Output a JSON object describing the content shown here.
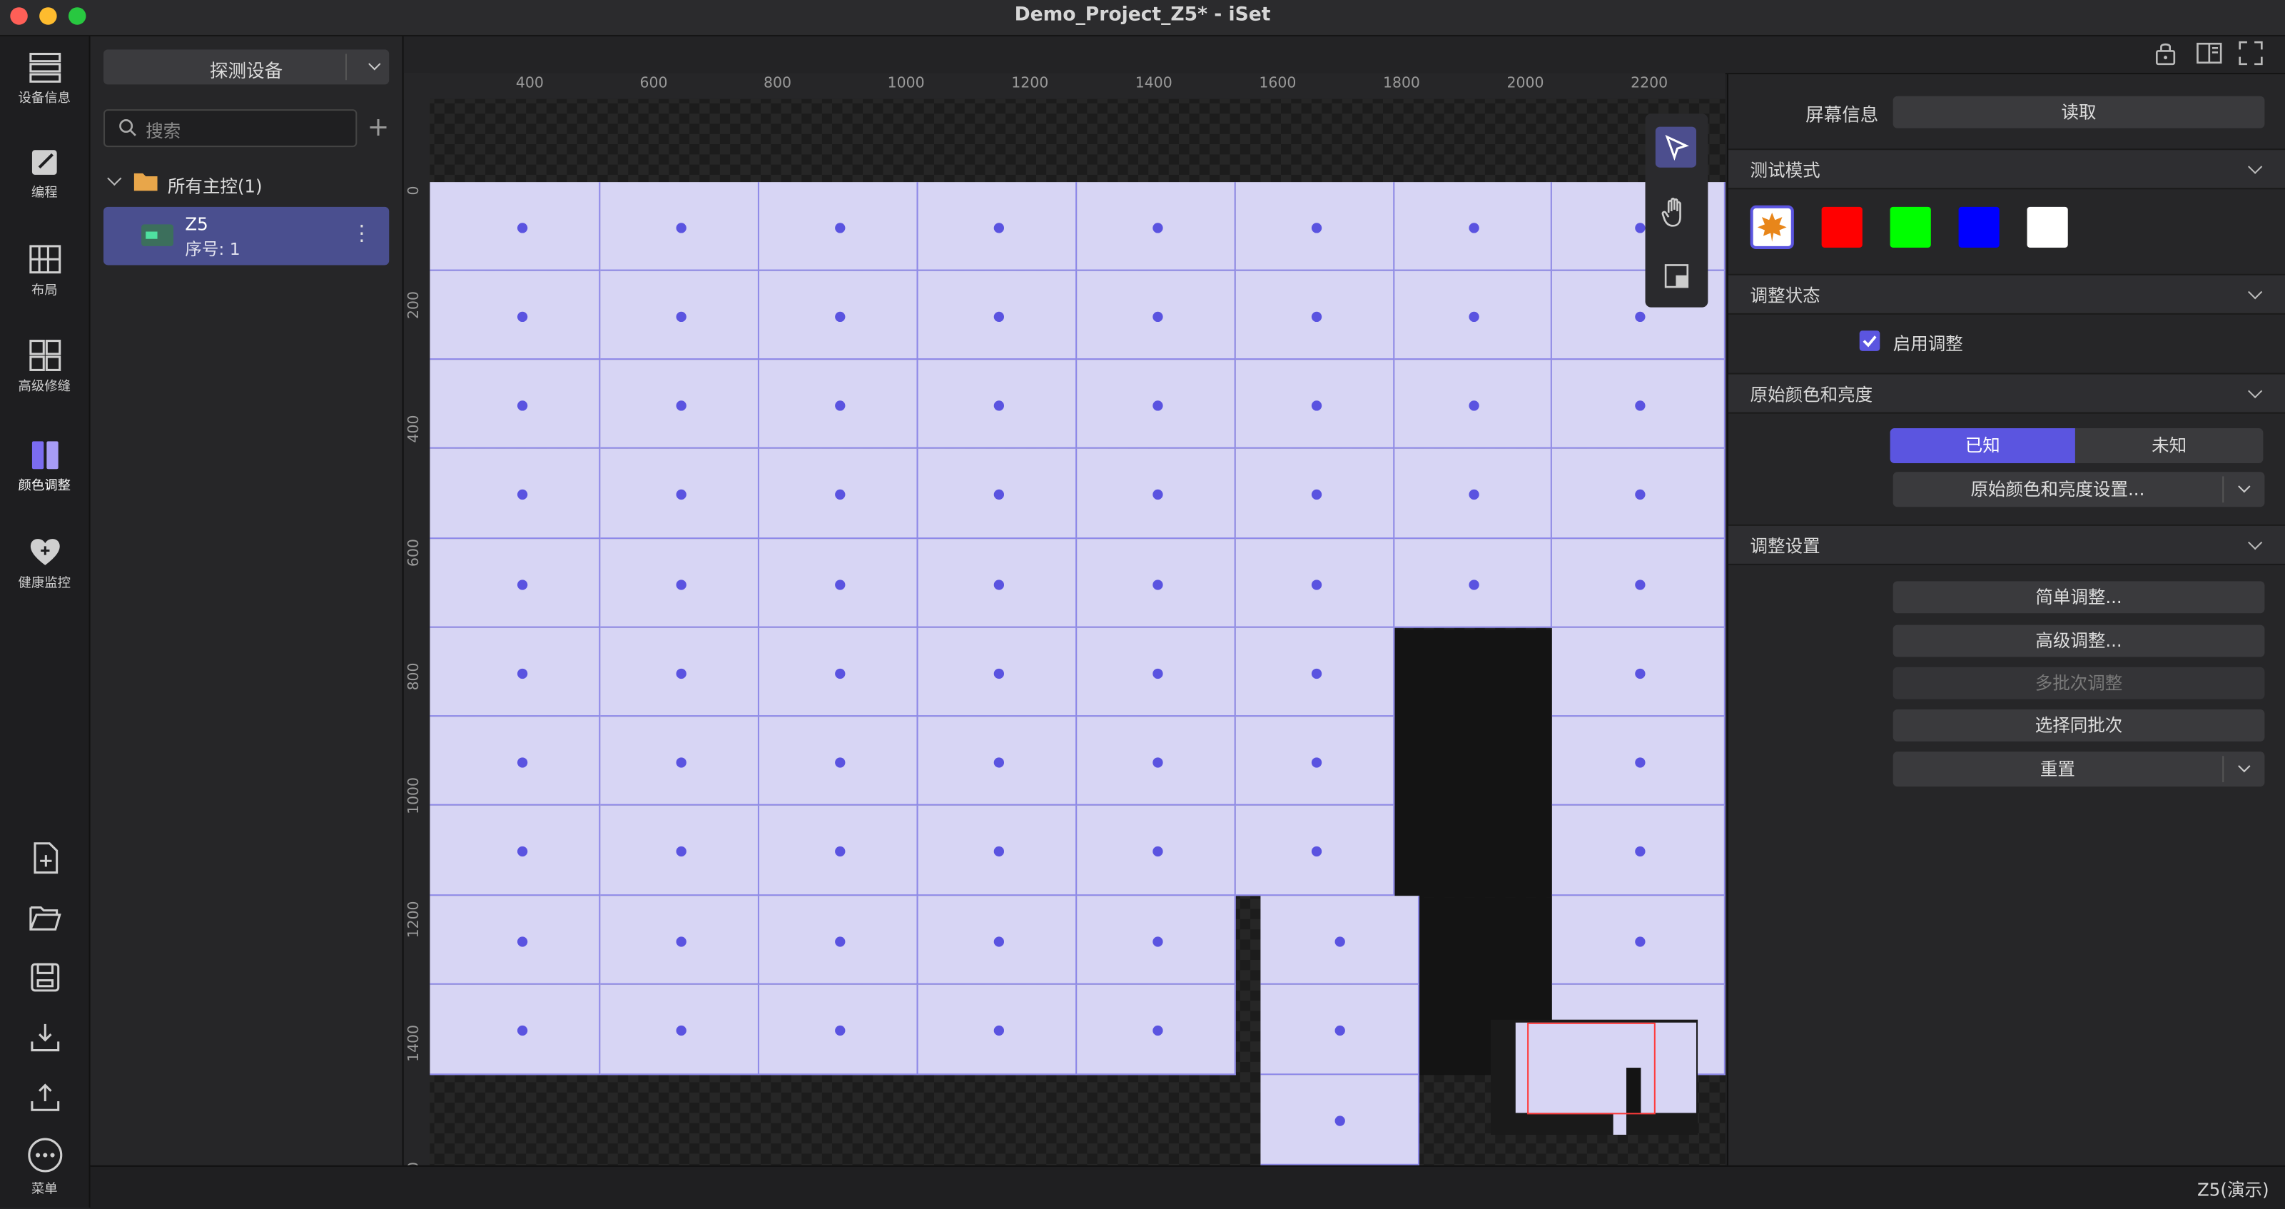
{
  "window": {
    "title": "Demo_Project_Z5* - iSet"
  },
  "rail": {
    "items": [
      {
        "label": "设备信息",
        "icon": "device-info-icon"
      },
      {
        "label": "编程",
        "icon": "edit-icon"
      },
      {
        "label": "布局",
        "icon": "layout-icon"
      },
      {
        "label": "高级修缝",
        "icon": "grid-icon"
      },
      {
        "label": "颜色调整",
        "icon": "color-adjust-icon"
      },
      {
        "label": "健康监控",
        "icon": "heart-icon"
      }
    ],
    "menu_label": "菜单"
  },
  "device_panel": {
    "detect_button": "探测设备",
    "search_placeholder": "搜索",
    "group_label": "所有主控(1)",
    "device": {
      "name": "Z5",
      "serial": "序号: 1"
    }
  },
  "ruler": {
    "x_ticks": [
      "400",
      "600",
      "800",
      "1000",
      "1200",
      "1400",
      "1600",
      "1800",
      "2000",
      "2200"
    ],
    "y_ticks": [
      "0",
      "200",
      "400",
      "600",
      "800",
      "1000",
      "1200",
      "1400",
      "0"
    ]
  },
  "right_panel": {
    "screen_info_label": "屏幕信息",
    "read_button": "读取",
    "test_mode": {
      "title": "测试模式",
      "swatches": [
        "#ffffff",
        "#ff0000",
        "#00ff00",
        "#0000ff",
        "#ffffff"
      ]
    },
    "adjust_state": {
      "title": "调整状态",
      "enable_label": "启用调整",
      "enabled": true
    },
    "original_color": {
      "title": "原始颜色和亮度",
      "known": "已知",
      "unknown": "未知",
      "settings_button": "原始颜色和亮度设置..."
    },
    "adjust_settings": {
      "title": "调整设置",
      "simple": "简单调整...",
      "advanced": "高级调整...",
      "multi_batch": "多批次调整",
      "select_batch": "选择同批次",
      "reset": "重置"
    }
  },
  "status": {
    "text": "Z5(演示)"
  },
  "colors": {
    "accent": "#5b55e0",
    "tile": "#d7d5f4",
    "background": "#232325"
  }
}
